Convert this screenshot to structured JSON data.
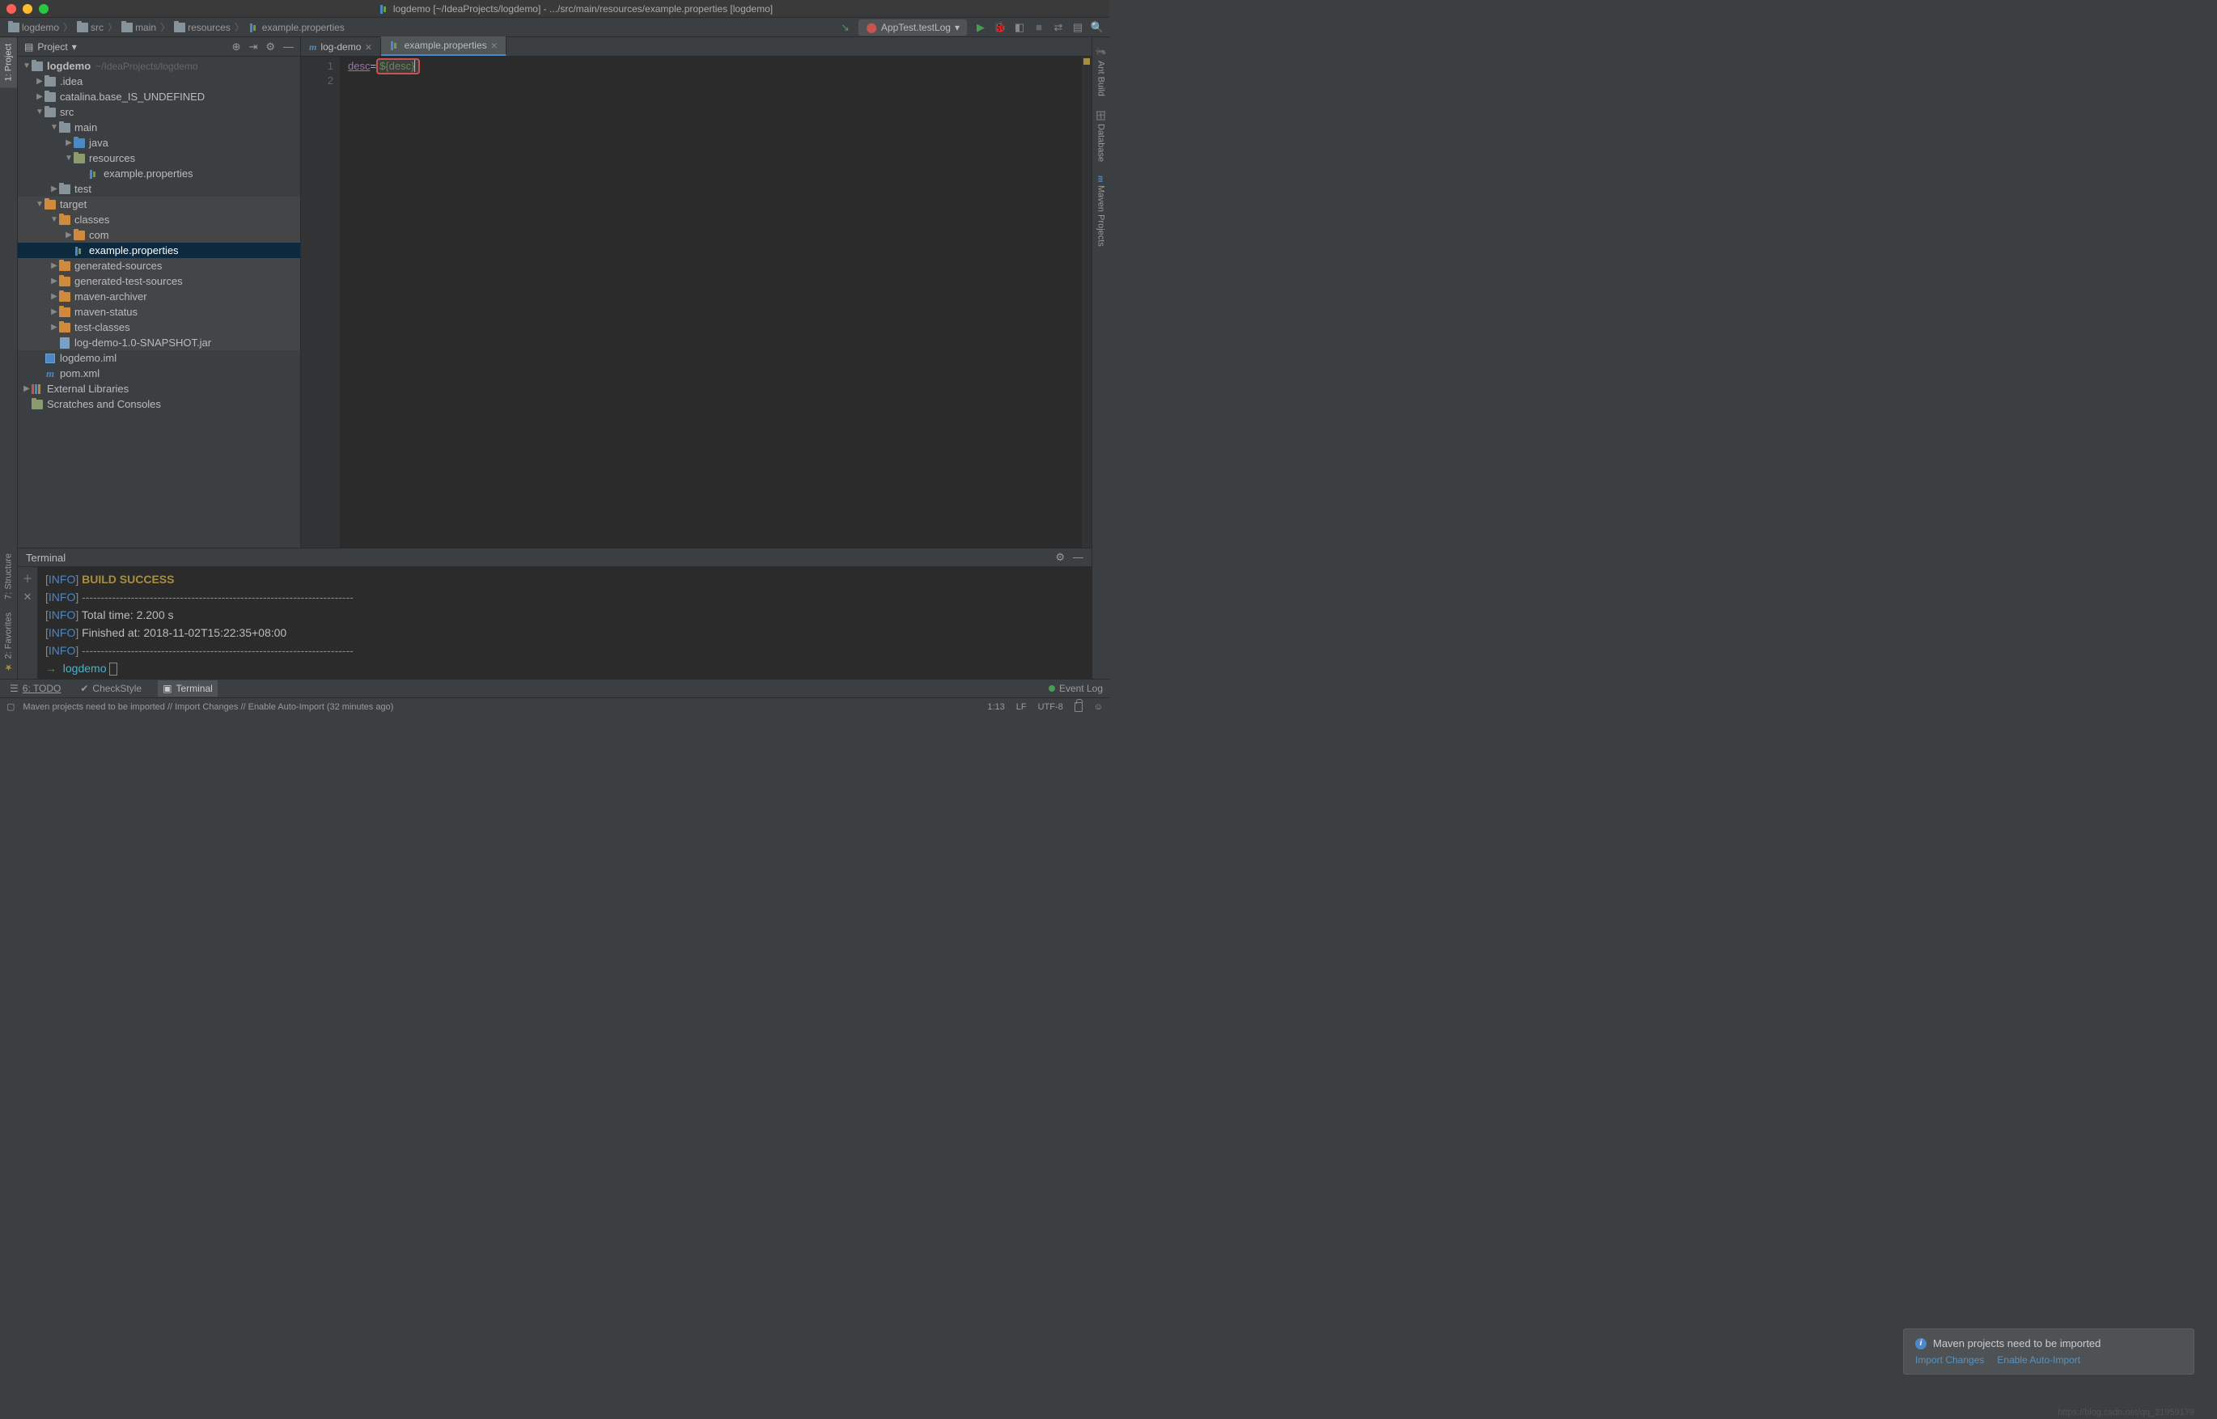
{
  "window": {
    "title": "logdemo [~/IdeaProjects/logdemo] - .../src/main/resources/example.properties [logdemo]"
  },
  "breadcrumb": {
    "items": [
      "logdemo",
      "src",
      "main",
      "resources",
      "example.properties"
    ]
  },
  "runconfig": {
    "label": "AppTest.testLog"
  },
  "leftTabs": {
    "project": "1: Project",
    "structure": "7: Structure",
    "favorites": "2: Favorites"
  },
  "rightTabs": {
    "ant": "Ant Build",
    "database": "Database",
    "maven": "Maven Projects"
  },
  "projectPanel": {
    "title": "Project",
    "tree": {
      "root_name": "logdemo",
      "root_hint": "~/IdeaProjects/logdemo",
      "idea": ".idea",
      "catalina": "catalina.base_IS_UNDEFINED",
      "src": "src",
      "main": "main",
      "java": "java",
      "resources": "resources",
      "exprops": "example.properties",
      "test": "test",
      "target": "target",
      "classes": "classes",
      "com": "com",
      "exprops2": "example.properties",
      "gensources": "generated-sources",
      "gentestsources": "generated-test-sources",
      "marchiver": "maven-archiver",
      "mstatus": "maven-status",
      "testclasses": "test-classes",
      "snapshotjar": "log-demo-1.0-SNAPSHOT.jar",
      "iml": "logdemo.iml",
      "pom": "pom.xml",
      "extlib": "External Libraries",
      "scratches": "Scratches and Consoles"
    }
  },
  "editor": {
    "tabs": {
      "t1": "log-demo",
      "t2": "example.properties"
    },
    "lines": {
      "l1": "1",
      "l2": "2"
    },
    "code": {
      "key": "desc",
      "eq": "=",
      "val": "${desc}"
    }
  },
  "terminal": {
    "title": "Terminal",
    "infoTag": "INFO",
    "buildSuccess": "BUILD SUCCESS",
    "sep": "------------------------------------------------------------------------",
    "totalTime": "Total time: 2.200 s",
    "finished": "Finished at: 2018-11-02T15:22:35+08:00",
    "promptPath": "logdemo",
    "arrow": "→"
  },
  "notification": {
    "title": "Maven projects need to be imported",
    "link1": "Import Changes",
    "link2": "Enable Auto-Import"
  },
  "bottomTabs": {
    "todo": "6: TODO",
    "checkstyle": "CheckStyle",
    "terminal": "Terminal",
    "eventlog": "Event Log"
  },
  "statusBar": {
    "msg": "Maven projects need to be imported // Import Changes // Enable Auto-Import (32 minutes ago)",
    "pos": "1:13",
    "lf": "LF",
    "encoding": "UTF-8"
  },
  "watermark": "https://blog.csdn.net/qq_21959179"
}
